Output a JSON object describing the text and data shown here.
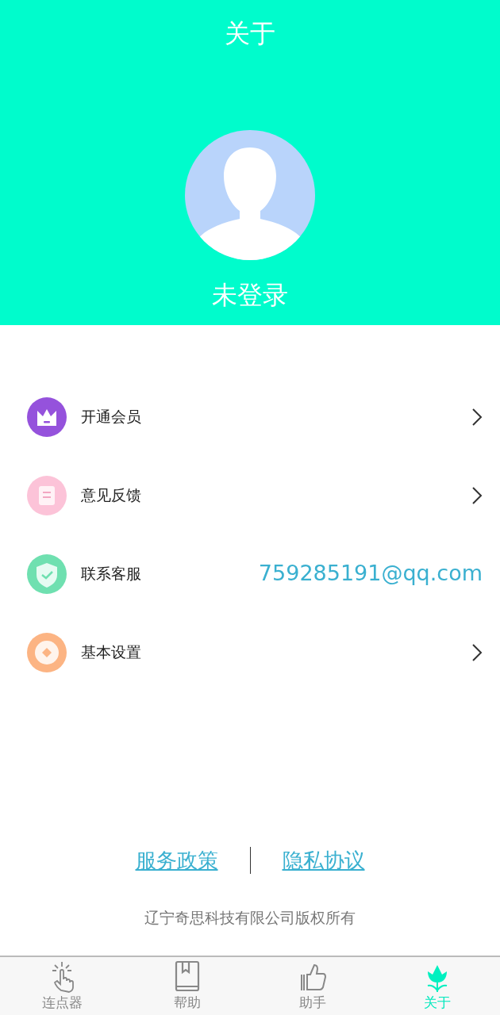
{
  "header": {
    "title": "关于",
    "user_name": "未登录"
  },
  "menu": [
    {
      "label": "开通会员",
      "kind": "link"
    },
    {
      "label": "意见反馈",
      "kind": "link"
    },
    {
      "label": "联系客服",
      "kind": "info",
      "value": "759285191@qq.com"
    },
    {
      "label": "基本设置",
      "kind": "link"
    }
  ],
  "footer": {
    "links": [
      "服务政策",
      "隐私协议"
    ],
    "copyright": "辽宁奇思科技有限公司版权所有"
  },
  "tab_bar": [
    {
      "label": "连点器",
      "selected": false
    },
    {
      "label": "帮助",
      "selected": false
    },
    {
      "label": "助手",
      "selected": false
    },
    {
      "label": "关于",
      "selected": true
    }
  ]
}
